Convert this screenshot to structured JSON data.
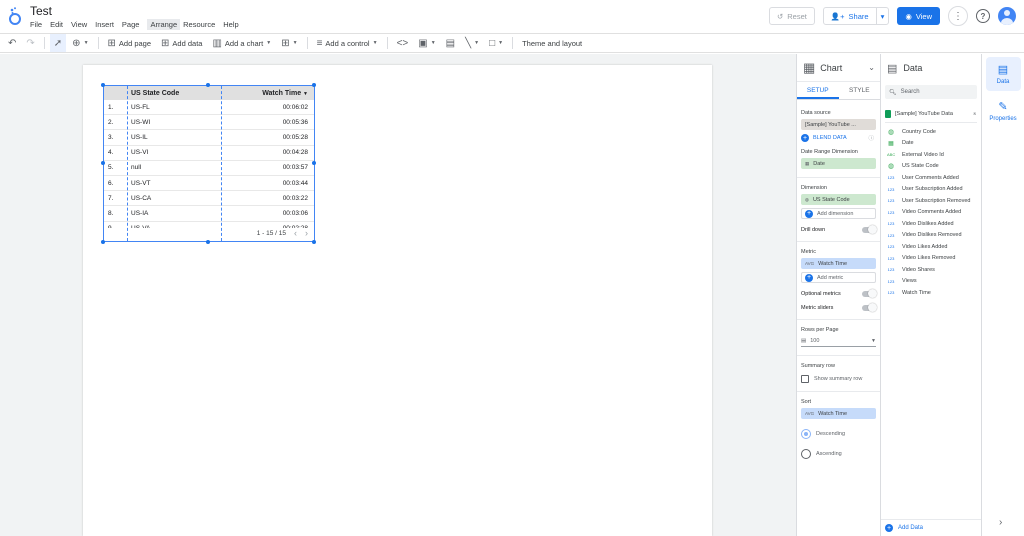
{
  "app": {
    "title": "Test"
  },
  "menu": [
    "File",
    "Edit",
    "View",
    "Insert",
    "Page",
    "Arrange",
    "Resource",
    "Help"
  ],
  "header": {
    "reset_label": "Reset",
    "share_label": "Share",
    "view_label": "View"
  },
  "toolbar": {
    "add_page": "Add page",
    "add_data": "Add data",
    "add_chart": "Add a chart",
    "add_control": "Add a control",
    "theme_layout": "Theme and layout"
  },
  "table": {
    "col_dimension": "US State Code",
    "col_metric": "Watch Time",
    "rows": [
      {
        "n": "1.",
        "state": "US-FL",
        "time": "00:06:02"
      },
      {
        "n": "2.",
        "state": "US-WI",
        "time": "00:05:36"
      },
      {
        "n": "3.",
        "state": "US-IL",
        "time": "00:05:28"
      },
      {
        "n": "4.",
        "state": "US-VI",
        "time": "00:04:28"
      },
      {
        "n": "5.",
        "state": "null",
        "time": "00:03:57"
      },
      {
        "n": "6.",
        "state": "US-VT",
        "time": "00:03:44"
      },
      {
        "n": "7.",
        "state": "US-CA",
        "time": "00:03:22"
      },
      {
        "n": "8.",
        "state": "US-IA",
        "time": "00:03:06"
      },
      {
        "n": "9.",
        "state": "US-VA",
        "time": "00:02:28"
      }
    ],
    "pager": "1 - 15 / 15"
  },
  "chart_panel": {
    "title": "Chart",
    "tab_setup": "SETUP",
    "tab_style": "STYLE",
    "data_source_label": "Data source",
    "data_source_value": "[Sample] YouTube ...",
    "blend_label": "BLEND DATA",
    "date_range_label": "Date Range Dimension",
    "date_range_value": "Date",
    "dimension_label": "Dimension",
    "dimension_value": "US State Code",
    "add_dimension": "Add dimension",
    "drill_down": "Drill down",
    "metric_label": "Metric",
    "metric_value": "Watch Time",
    "metric_agg": "AVG",
    "add_metric": "Add metric",
    "optional_metrics": "Optional metrics",
    "metric_sliders": "Metric sliders",
    "rows_per_page_label": "Rows per Page",
    "rows_per_page_value": "100",
    "summary_row_label": "Summary row",
    "show_summary_row": "Show summary row",
    "sort_label": "Sort",
    "sort_value": "Watch Time",
    "sort_agg": "AVG",
    "descending": "Descending",
    "ascending": "Ascending"
  },
  "data_panel": {
    "title": "Data",
    "search_placeholder": "Search",
    "source": "[Sample] YouTube Data",
    "fields": [
      {
        "type": "geo",
        "name": "Country Code"
      },
      {
        "type": "date",
        "name": "Date"
      },
      {
        "type": "abc",
        "name": "External Video Id"
      },
      {
        "type": "geo",
        "name": "US State Code"
      },
      {
        "type": "123",
        "name": "User Comments Added"
      },
      {
        "type": "123",
        "name": "User Subscription Added"
      },
      {
        "type": "123",
        "name": "User Subscription Removed"
      },
      {
        "type": "123",
        "name": "Video Comments Added"
      },
      {
        "type": "123",
        "name": "Video Dislikes Added"
      },
      {
        "type": "123",
        "name": "Video Dislikes Removed"
      },
      {
        "type": "123",
        "name": "Video Likes Added"
      },
      {
        "type": "123",
        "name": "Video Likes Removed"
      },
      {
        "type": "123",
        "name": "Video Shares"
      },
      {
        "type": "123",
        "name": "Views"
      },
      {
        "type": "123",
        "name": "Watch Time"
      }
    ],
    "add_data": "Add Data"
  },
  "rail": {
    "data_label": "Data",
    "properties_label": "Properties"
  }
}
